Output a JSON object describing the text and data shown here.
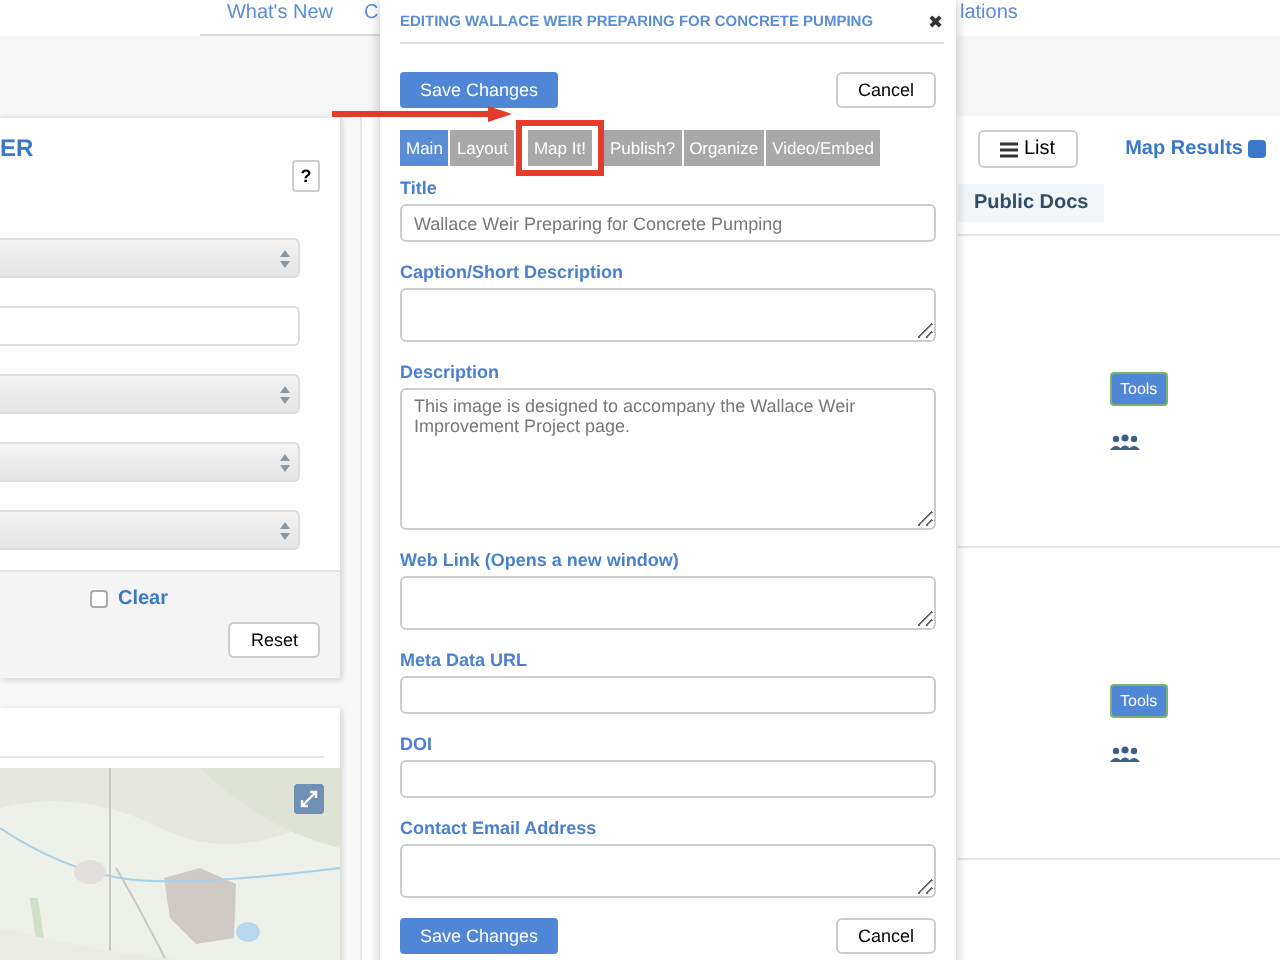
{
  "top_nav": [
    {
      "label": "What's New"
    },
    {
      "label": "C"
    },
    {
      "label": "lations"
    }
  ],
  "filter_panel": {
    "title": "ER",
    "help": "?",
    "fields": [
      {
        "kind": "select"
      },
      {
        "kind": "input"
      },
      {
        "kind": "select"
      },
      {
        "kind": "select"
      },
      {
        "kind": "select"
      }
    ],
    "clear": {
      "label": "Clear",
      "checked": false
    },
    "reset": "Reset"
  },
  "results": {
    "list_button": "List",
    "map_results": {
      "label": "Map Results",
      "checked": true
    },
    "column_header": "Public Docs",
    "rows": [
      {
        "tools": "Tools"
      },
      {
        "tools": "Tools"
      }
    ]
  },
  "dialog": {
    "title": "EDITING WALLACE WEIR PREPARING FOR CONCRETE PUMPING",
    "close": "✖",
    "save": "Save Changes",
    "cancel": "Cancel",
    "tabs": [
      {
        "label": "Main",
        "selected": true,
        "highlighted": false
      },
      {
        "label": "Layout",
        "selected": false,
        "highlighted": false
      },
      {
        "label": "Map It!",
        "selected": false,
        "highlighted": true
      },
      {
        "label": "Publish?",
        "selected": false,
        "highlighted": false
      },
      {
        "label": "Organize",
        "selected": false,
        "highlighted": false
      },
      {
        "label": "Video/Embed",
        "selected": false,
        "highlighted": false
      }
    ],
    "fields": [
      {
        "label": "Title",
        "kind": "input",
        "value": "Wallace Weir Preparing for Concrete Pumping"
      },
      {
        "label": "Caption/Short Description",
        "kind": "textarea"
      },
      {
        "label": "Description",
        "kind": "bigtextarea",
        "value": "This image is designed to accompany the Wallace Weir Improvement Project page."
      },
      {
        "label": "Web Link (Opens a new window)",
        "kind": "textarea"
      },
      {
        "label": "Meta Data URL",
        "kind": "input"
      },
      {
        "label": "DOI",
        "kind": "input"
      },
      {
        "label": "Contact Email Address",
        "kind": "textarea"
      }
    ],
    "footer_save": "Save Changes",
    "footer_cancel": "Cancel"
  }
}
